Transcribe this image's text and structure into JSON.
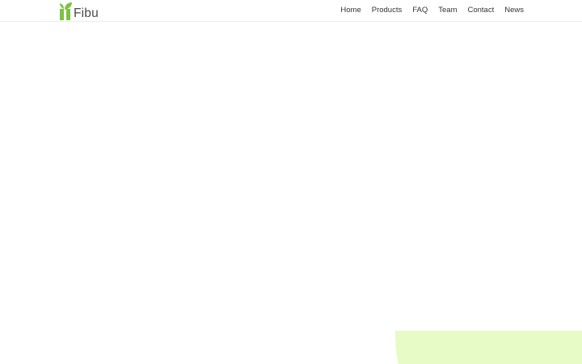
{
  "header": {
    "logo": {
      "text": "Fibu",
      "icon": "leaf-logo-icon"
    },
    "nav": [
      {
        "label": "Home"
      },
      {
        "label": "Products"
      },
      {
        "label": "FAQ"
      },
      {
        "label": "Team"
      },
      {
        "label": "Contact"
      },
      {
        "label": "News"
      }
    ]
  },
  "colors": {
    "brand_green": "#7cc242",
    "accent_light_green": "#e6fbc5",
    "nav_text": "#333333"
  }
}
